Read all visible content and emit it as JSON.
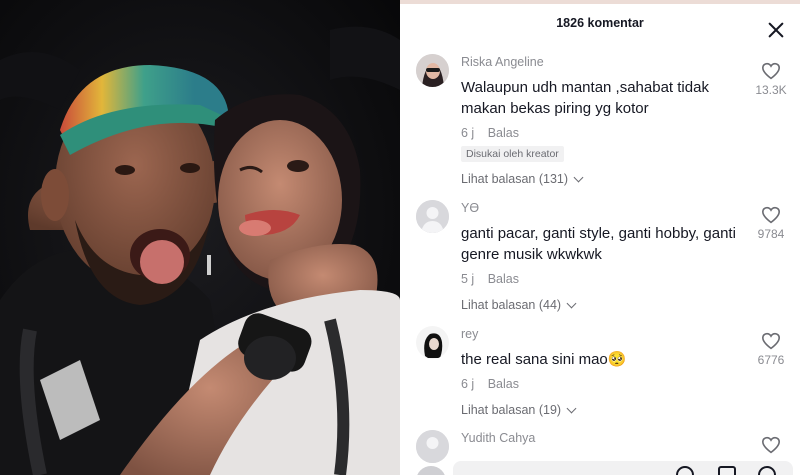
{
  "header": {
    "comment_count": "1826 komentar"
  },
  "comments": [
    {
      "username": "Riska Angeline",
      "text": "Walaupun udh mantan ,sahabat tidak makan bekas piring yg kotor",
      "time": "6 j",
      "reply": "Balas",
      "badge": "Disukai oleh kreator",
      "replies": "Lihat balasan (131)",
      "likes": "13.3K"
    },
    {
      "username": "Yϴ",
      "text": "ganti pacar, ganti style, ganti hobby, ganti genre musik wkwkwk",
      "time": "5 j",
      "reply": "Balas",
      "replies": "Lihat balasan (44)",
      "likes": "9784"
    },
    {
      "username": "rey",
      "text": "the real sana sini mao🥺",
      "time": "6 j",
      "reply": "Balas",
      "replies": "Lihat balasan (19)",
      "likes": "6776"
    },
    {
      "username": "Yudith Cahya"
    }
  ],
  "colors": {
    "text": "#161823",
    "muted": "#8a8b91",
    "accent_cap": "#3fa08a"
  },
  "icons": {
    "close": "close-icon",
    "like": "heart-outline-icon",
    "expand": "chevron-down-icon"
  }
}
